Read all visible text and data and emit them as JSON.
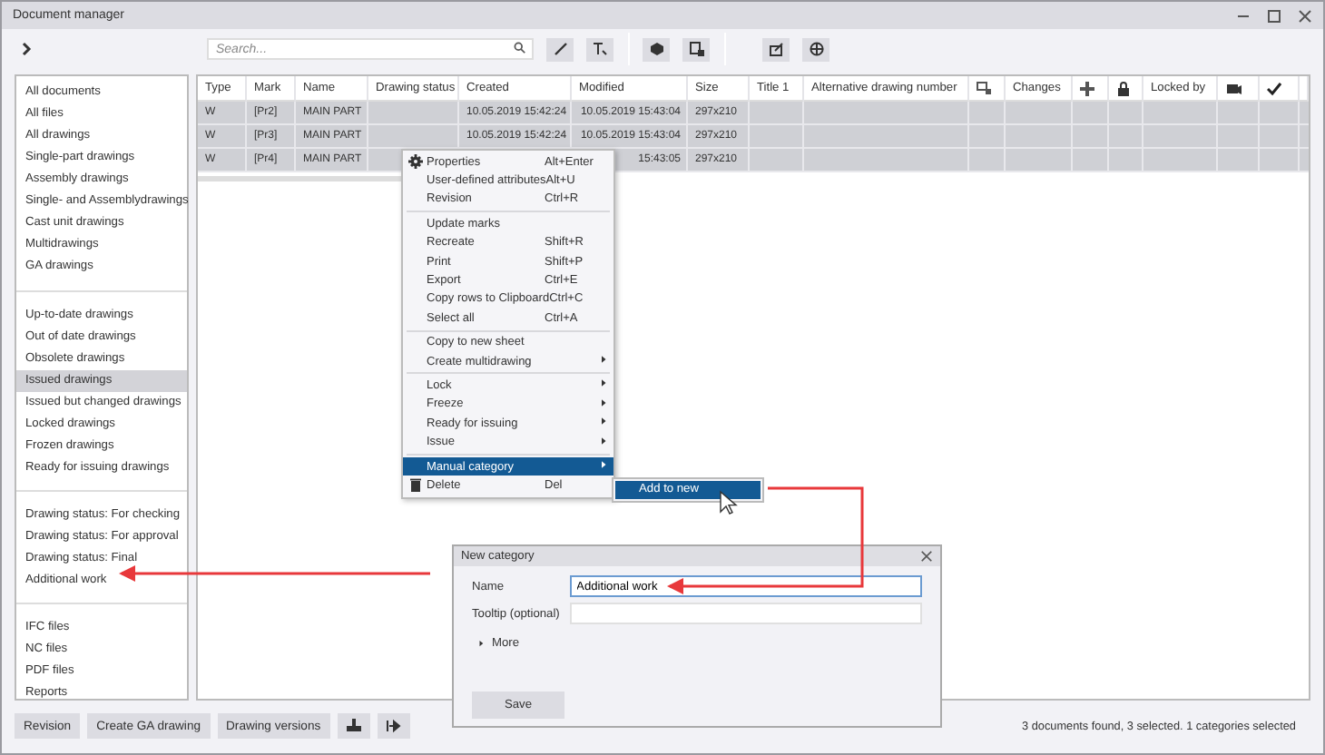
{
  "window": {
    "title": "Document manager"
  },
  "toolbar": {
    "search": {
      "placeholder": "Search..."
    }
  },
  "sidebar": {
    "groups": [
      [
        {
          "label": "All documents",
          "selected": false
        },
        {
          "label": "All files",
          "selected": false
        },
        {
          "label": "All drawings",
          "selected": false
        },
        {
          "label": "Single-part drawings",
          "selected": false
        },
        {
          "label": "Assembly drawings",
          "selected": false
        },
        {
          "label": "Single- and Assemblydrawings",
          "selected": false
        },
        {
          "label": "Cast unit drawings",
          "selected": false
        },
        {
          "label": "Multidrawings",
          "selected": false
        },
        {
          "label": "GA drawings",
          "selected": false
        }
      ],
      [
        {
          "label": "Up-to-date drawings",
          "selected": false
        },
        {
          "label": "Out of date drawings",
          "selected": false
        },
        {
          "label": "Obsolete drawings",
          "selected": false
        },
        {
          "label": "Issued drawings",
          "selected": true
        },
        {
          "label": "Issued but changed drawings",
          "selected": false
        },
        {
          "label": "Locked drawings",
          "selected": false
        },
        {
          "label": "Frozen drawings",
          "selected": false
        },
        {
          "label": "Ready for issuing drawings",
          "selected": false
        }
      ],
      [
        {
          "label": "Drawing status: For checking",
          "selected": false
        },
        {
          "label": "Drawing status: For approval",
          "selected": false
        },
        {
          "label": "Drawing status: Final",
          "selected": false
        },
        {
          "label": "Additional work",
          "selected": false
        }
      ],
      [
        {
          "label": "IFC files",
          "selected": false
        },
        {
          "label": "NC files",
          "selected": false
        },
        {
          "label": "PDF files",
          "selected": false
        },
        {
          "label": "Reports",
          "selected": false
        }
      ]
    ]
  },
  "table": {
    "columns": [
      {
        "kind": "text",
        "label": "Type"
      },
      {
        "kind": "text",
        "label": "Mark"
      },
      {
        "kind": "text",
        "label": "Name"
      },
      {
        "kind": "text",
        "label": "Drawing status"
      },
      {
        "kind": "text",
        "label": "Created"
      },
      {
        "kind": "text",
        "label": "Modified"
      },
      {
        "kind": "text",
        "label": "Size"
      },
      {
        "kind": "text",
        "label": "Title 1"
      },
      {
        "kind": "text",
        "label": "Alternative drawing number"
      },
      {
        "kind": "icon"
      },
      {
        "kind": "text",
        "label": "Changes"
      },
      {
        "kind": "icon"
      },
      {
        "kind": "icon"
      },
      {
        "kind": "text",
        "label": "Locked by"
      },
      {
        "kind": "icon"
      },
      {
        "kind": "icon"
      }
    ],
    "rows": [
      {
        "selected": true,
        "cells": [
          "W",
          "[Pr2]",
          "MAIN PART",
          "",
          "10.05.2019 15:42:24",
          "10.05.2019 15:43:04",
          "297x210"
        ]
      },
      {
        "selected": true,
        "cells": [
          "W",
          "[Pr3]",
          "MAIN PART",
          "",
          "10.05.2019 15:42:24",
          "10.05.2019 15:43:04",
          "297x210"
        ]
      },
      {
        "selected": true,
        "cells": [
          "W",
          "[Pr4]",
          "MAIN PART",
          "",
          "",
          "15:43:05",
          "297x210"
        ]
      }
    ]
  },
  "context_menu": {
    "groups": [
      [
        {
          "label": "Properties",
          "shortcut": "Alt+Enter",
          "submenu": false,
          "selected": false
        },
        {
          "label": "User-defined attributes",
          "shortcut": "Alt+U",
          "submenu": false,
          "selected": false
        },
        {
          "label": "Revision",
          "shortcut": "Ctrl+R",
          "submenu": false,
          "selected": false
        }
      ],
      [
        {
          "label": "Update marks",
          "submenu": false,
          "selected": false
        },
        {
          "label": "Recreate",
          "shortcut": "Shift+R",
          "submenu": false,
          "selected": false
        },
        {
          "label": "Print",
          "shortcut": "Shift+P",
          "submenu": false,
          "selected": false
        },
        {
          "label": "Export",
          "shortcut": "Ctrl+E",
          "submenu": false,
          "selected": false
        },
        {
          "label": "Copy rows to Clipboard",
          "shortcut": "Ctrl+C",
          "submenu": false,
          "selected": false
        },
        {
          "label": "Select all",
          "shortcut": "Ctrl+A",
          "submenu": false,
          "selected": false
        }
      ],
      [
        {
          "label": "Copy to new sheet",
          "submenu": false,
          "selected": false
        },
        {
          "label": "Create multidrawing",
          "submenu": true,
          "selected": false
        }
      ],
      [
        {
          "label": "Lock",
          "submenu": true,
          "selected": false
        },
        {
          "label": "Freeze",
          "submenu": true,
          "selected": false
        },
        {
          "label": "Ready for issuing",
          "submenu": true,
          "selected": false
        },
        {
          "label": "Issue",
          "submenu": true,
          "selected": false
        }
      ],
      [
        {
          "label": "Manual category",
          "submenu": true,
          "selected": true
        },
        {
          "label": "Delete",
          "shortcut": "Del",
          "submenu": false,
          "selected": false
        }
      ]
    ]
  },
  "submenu": {
    "items": [
      {
        "label": "Add to new",
        "selected": true
      }
    ]
  },
  "dialog": {
    "title": "New category",
    "fields": [
      {
        "label": "Name",
        "value": "Additional work"
      },
      {
        "label": "Tooltip (optional)"
      }
    ],
    "expander": "More",
    "button": "Save"
  },
  "bottom_bar": {
    "buttons": [
      "Revision",
      "Create GA drawing",
      "Drawing versions"
    ],
    "status": "3 documents found, 3 selected. 1 categories selected"
  }
}
